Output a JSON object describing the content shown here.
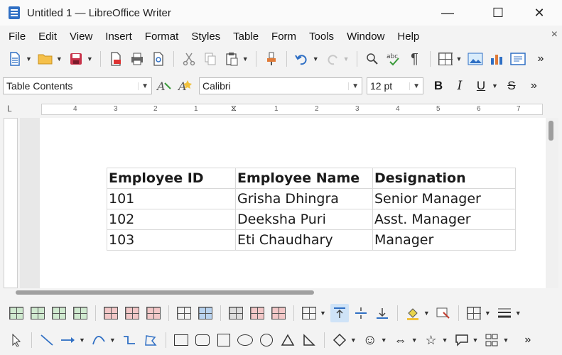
{
  "window": {
    "title": "Untitled 1 — LibreOffice Writer",
    "minimize": "—",
    "maximize": "☐",
    "close": "✕"
  },
  "menubar": {
    "items": [
      "File",
      "Edit",
      "View",
      "Insert",
      "Format",
      "Styles",
      "Table",
      "Form",
      "Tools",
      "Window",
      "Help"
    ],
    "close": "×"
  },
  "formatting": {
    "paragraph_style": "Table Contents",
    "font_name": "Calibri",
    "font_size": "12 pt",
    "bold": "B",
    "italic": "I",
    "underline": "U",
    "strike": "S",
    "more": "»"
  },
  "ruler": {
    "ticks": [
      "4",
      "3",
      "2",
      "1",
      "1",
      "2",
      "3",
      "4",
      "5",
      "6",
      "7"
    ]
  },
  "table": {
    "headers": [
      "Employee ID",
      "Employee Name",
      "Designation"
    ],
    "rows": [
      [
        "101",
        "Grisha Dhingra",
        "Senior Manager"
      ],
      [
        "102",
        "Deeksha Puri",
        "Asst. Manager"
      ],
      [
        "103",
        "Eti Chaudhary",
        "Manager"
      ]
    ]
  }
}
